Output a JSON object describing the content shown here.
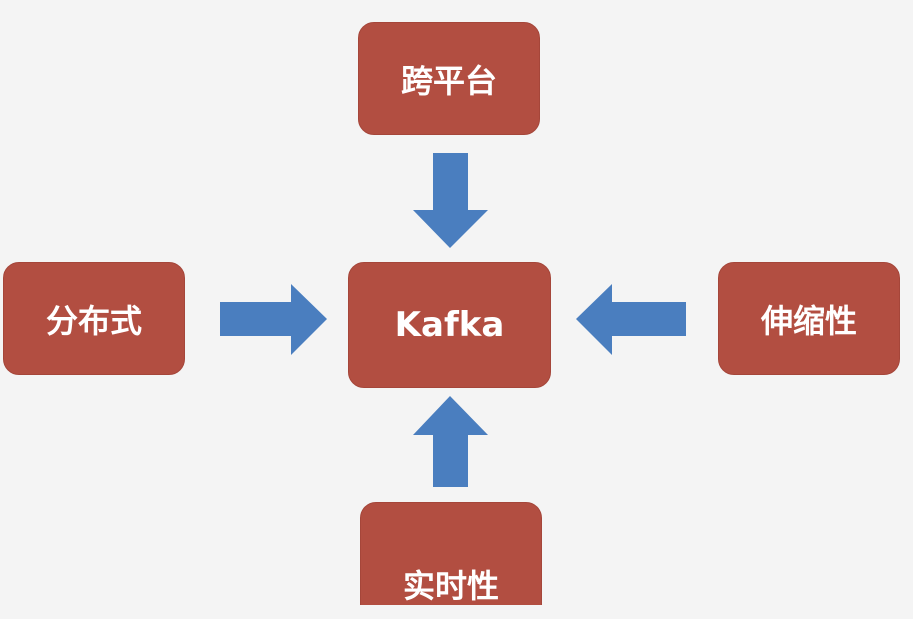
{
  "diagram": {
    "center": {
      "label": "Kafka"
    },
    "nodes": {
      "top": {
        "label": "跨平台"
      },
      "left": {
        "label": "分布式"
      },
      "right": {
        "label": "伸缩性"
      },
      "bottom": {
        "label": "实时性"
      }
    },
    "colors": {
      "box_fill": "#b24e41",
      "arrow_fill": "#4a7ebf",
      "text": "#ffffff",
      "background": "#f4f4f4"
    },
    "edges": [
      {
        "from": "top",
        "to": "center"
      },
      {
        "from": "left",
        "to": "center"
      },
      {
        "from": "right",
        "to": "center"
      },
      {
        "from": "bottom",
        "to": "center"
      }
    ]
  }
}
